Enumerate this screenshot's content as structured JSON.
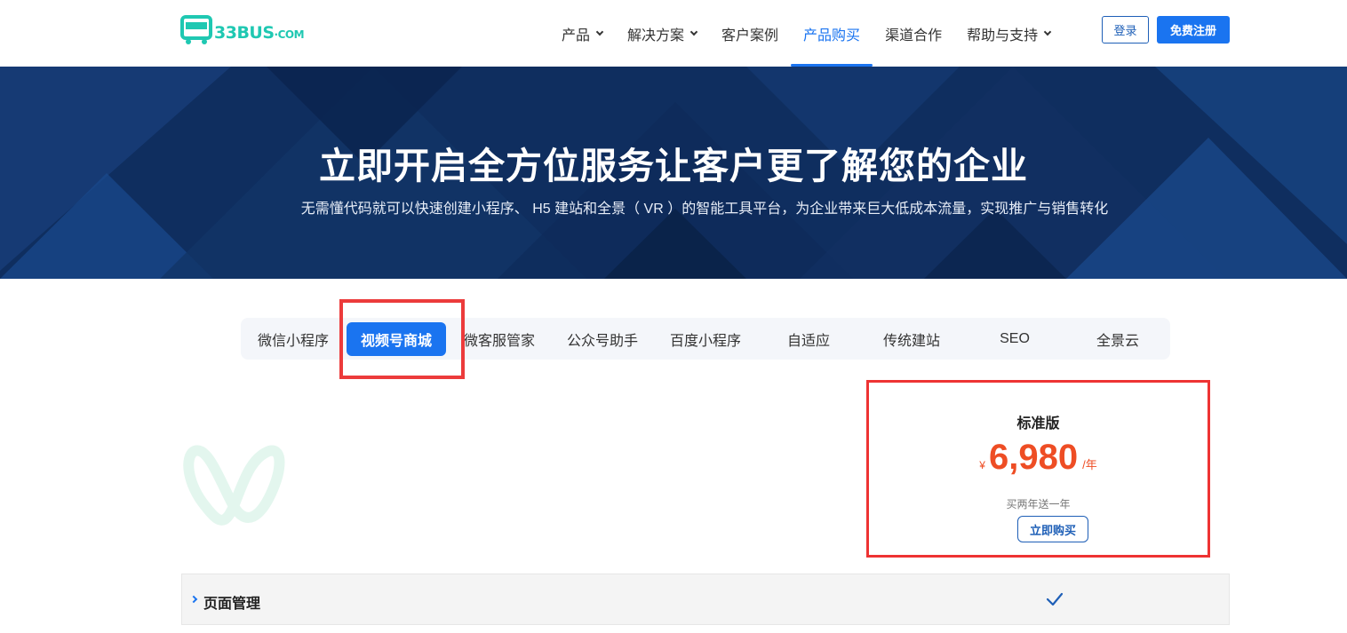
{
  "logo": {
    "text": "33BUS",
    "suffix": "·COM"
  },
  "nav": [
    {
      "label": "产品",
      "dropdown": true,
      "active": false
    },
    {
      "label": "解决方案",
      "dropdown": true,
      "active": false
    },
    {
      "label": "客户案例",
      "dropdown": false,
      "active": false
    },
    {
      "label": "产品购买",
      "dropdown": false,
      "active": true
    },
    {
      "label": "渠道合作",
      "dropdown": false,
      "active": false
    },
    {
      "label": "帮助与支持",
      "dropdown": true,
      "active": false
    }
  ],
  "header": {
    "login_label": "登录",
    "register_label": "免费注册"
  },
  "hero": {
    "title": "立即开启全方位服务让客户更了解您的企业",
    "subtitle": "无需懂代码就可以快速创建小程序、 H5 建站和全景（ VR ）的智能工具平台，为企业带来巨大低成本流量，实现推广与销售转化"
  },
  "tabs": [
    {
      "label": "微信小程序",
      "active": false
    },
    {
      "label": "视频号商城",
      "active": true
    },
    {
      "label": "微客服管家",
      "active": false
    },
    {
      "label": "公众号助手",
      "active": false
    },
    {
      "label": "百度小程序",
      "active": false
    },
    {
      "label": "自适应",
      "active": false
    },
    {
      "label": "传统建站",
      "active": false
    },
    {
      "label": "SEO",
      "active": false
    },
    {
      "label": "全景云",
      "active": false
    }
  ],
  "plan": {
    "name": "标准版",
    "currency": "¥",
    "price": "6,980",
    "unit": "/年",
    "promo": "买两年送一年",
    "buy_label": "立即购买"
  },
  "features": [
    {
      "label": "页面管理",
      "included": true
    }
  ],
  "colors": {
    "primary": "#1a74f0",
    "price": "#ee4d24",
    "highlight": "#ec3b3b",
    "logo": "#1fc8b2",
    "hero_bg": "#0f2e5f"
  }
}
